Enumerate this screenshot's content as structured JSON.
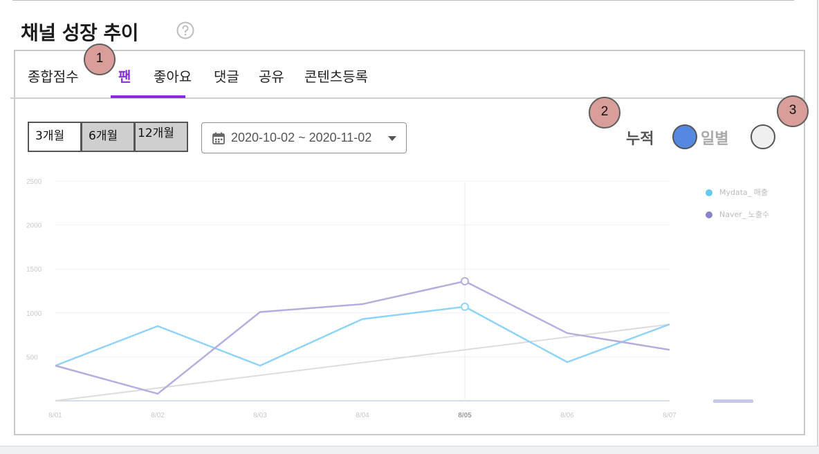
{
  "header": {
    "title": "채널 성장 추이",
    "help_icon": "question-circle-icon"
  },
  "tabs": [
    {
      "label": "종합점수",
      "active": false
    },
    {
      "label": "팬",
      "active": true
    },
    {
      "label": "좋아요",
      "active": false
    },
    {
      "label": "댓글",
      "active": false
    },
    {
      "label": "공유",
      "active": false
    },
    {
      "label": "콘텐츠등록",
      "active": false
    }
  ],
  "markers": [
    "1",
    "2",
    "3"
  ],
  "period_buttons": [
    {
      "label": "3개월",
      "selected": true
    },
    {
      "label": "6개월",
      "selected": false
    },
    {
      "label": "12개월",
      "selected": false
    }
  ],
  "date_range": {
    "value": "2020-10-02 ~ 2020-11-02",
    "icon": "calendar-icon"
  },
  "view_mode": {
    "cumulative_label": "누적",
    "daily_label": "일별",
    "cumulative_on": true,
    "daily_on": false
  },
  "colors": {
    "accent": "#8a2be2",
    "series_mydata": "#8fd3f7",
    "series_naver": "#b6addf",
    "trend": "#dcdcdc",
    "toggle_on": "#5588e0",
    "marker": "#d99d9a"
  },
  "chart_data": {
    "type": "line",
    "x": [
      "8/01",
      "8/02",
      "8/03",
      "8/04",
      "8/05",
      "8/06",
      "8/07"
    ],
    "highlight_x": "8/05",
    "yticks": [
      500,
      1000,
      1500,
      2000,
      2500
    ],
    "ylim": [
      0,
      2500
    ],
    "grid": true,
    "legend_position": "right",
    "series": [
      {
        "name": "Mydata_ 매출",
        "values": [
          400,
          850,
          400,
          930,
          1070,
          440,
          870
        ]
      },
      {
        "name": "Naver_ 노출수",
        "values": [
          400,
          80,
          1010,
          1100,
          1360,
          770,
          580
        ]
      }
    ],
    "trend": {
      "values": [
        0,
        870
      ]
    }
  }
}
